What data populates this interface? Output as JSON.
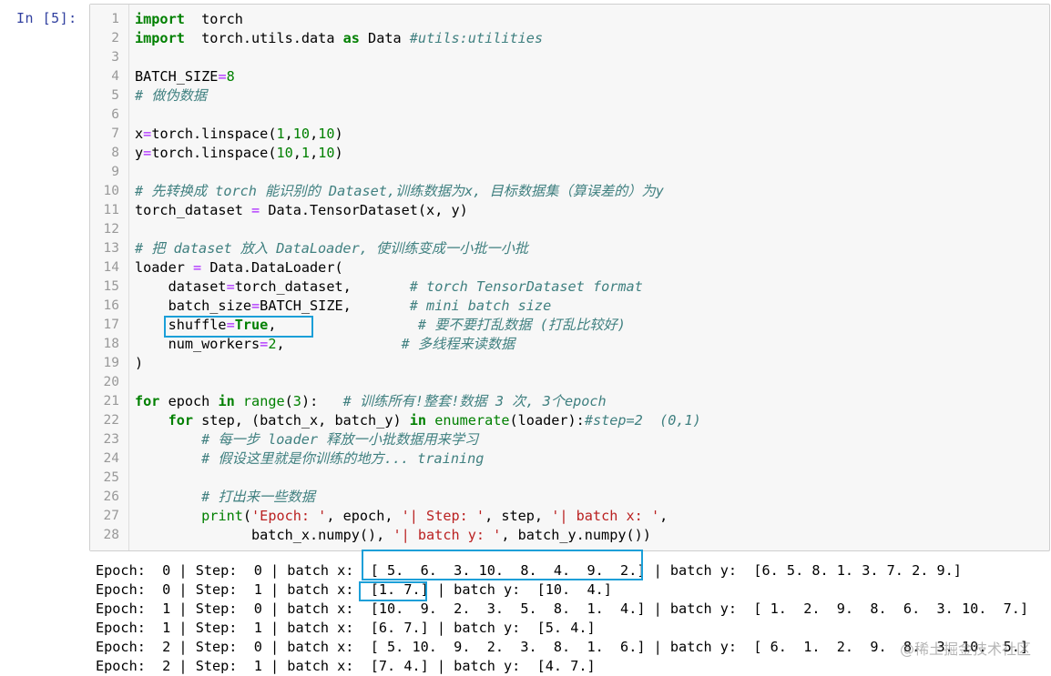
{
  "prompt": "In  [5]:",
  "code_lines": [
    {
      "n": "1",
      "segs": [
        [
          "kw",
          "import"
        ],
        [
          "",
          "  torch"
        ]
      ]
    },
    {
      "n": "2",
      "segs": [
        [
          "kw",
          "import"
        ],
        [
          "",
          "  torch.utils.data "
        ],
        [
          "kw",
          "as"
        ],
        [
          "",
          " Data "
        ],
        [
          "cm",
          "#utils:utilities"
        ]
      ]
    },
    {
      "n": "3",
      "segs": []
    },
    {
      "n": "4",
      "segs": [
        [
          "",
          "BATCH_SIZE"
        ],
        [
          "op",
          "="
        ],
        [
          "num",
          "8"
        ]
      ]
    },
    {
      "n": "5",
      "segs": [
        [
          "cm",
          "# 做伪数据"
        ]
      ]
    },
    {
      "n": "6",
      "segs": []
    },
    {
      "n": "7",
      "segs": [
        [
          "",
          "x"
        ],
        [
          "op",
          "="
        ],
        [
          "",
          "torch.linspace("
        ],
        [
          "num",
          "1"
        ],
        [
          "",
          ","
        ],
        [
          "num",
          "10"
        ],
        [
          "",
          ","
        ],
        [
          "num",
          "10"
        ],
        [
          "",
          ")"
        ]
      ]
    },
    {
      "n": "8",
      "segs": [
        [
          "",
          "y"
        ],
        [
          "op",
          "="
        ],
        [
          "",
          "torch.linspace("
        ],
        [
          "num",
          "10"
        ],
        [
          "",
          ","
        ],
        [
          "num",
          "1"
        ],
        [
          "",
          ","
        ],
        [
          "num",
          "10"
        ],
        [
          "",
          ")"
        ]
      ]
    },
    {
      "n": "9",
      "segs": []
    },
    {
      "n": "10",
      "segs": [
        [
          "cm",
          "# 先转换成 torch 能识别的 Dataset,训练数据为x, 目标数据集（算误差的）为y"
        ]
      ]
    },
    {
      "n": "11",
      "segs": [
        [
          "",
          "torch_dataset "
        ],
        [
          "op",
          "="
        ],
        [
          "",
          " Data.TensorDataset(x, y)"
        ]
      ]
    },
    {
      "n": "12",
      "segs": []
    },
    {
      "n": "13",
      "segs": [
        [
          "cm",
          "# 把 dataset 放入 DataLoader, 使训练变成一小批一小批"
        ]
      ]
    },
    {
      "n": "14",
      "segs": [
        [
          "",
          "loader "
        ],
        [
          "op",
          "="
        ],
        [
          "",
          " Data.DataLoader("
        ]
      ]
    },
    {
      "n": "15",
      "segs": [
        [
          "",
          "    dataset"
        ],
        [
          "op",
          "="
        ],
        [
          "",
          "torch_dataset,       "
        ],
        [
          "cm",
          "# torch TensorDataset format"
        ]
      ]
    },
    {
      "n": "16",
      "segs": [
        [
          "",
          "    batch_size"
        ],
        [
          "op",
          "="
        ],
        [
          "",
          "BATCH_SIZE,       "
        ],
        [
          "cm",
          "# mini batch size"
        ]
      ]
    },
    {
      "n": "17",
      "segs": [
        [
          "",
          "    shuffle"
        ],
        [
          "op",
          "="
        ],
        [
          "kw",
          "True"
        ],
        [
          "",
          ",                 "
        ],
        [
          "cm",
          "# 要不要打乱数据 (打乱比较好)"
        ]
      ]
    },
    {
      "n": "18",
      "segs": [
        [
          "",
          "    num_workers"
        ],
        [
          "op",
          "="
        ],
        [
          "num",
          "2"
        ],
        [
          "",
          ",              "
        ],
        [
          "cm",
          "# 多线程来读数据"
        ]
      ]
    },
    {
      "n": "19",
      "segs": [
        [
          "",
          ")"
        ]
      ]
    },
    {
      "n": "20",
      "segs": []
    },
    {
      "n": "21",
      "segs": [
        [
          "kw",
          "for"
        ],
        [
          "",
          " epoch "
        ],
        [
          "kw",
          "in"
        ],
        [
          "",
          " "
        ],
        [
          "bi",
          "range"
        ],
        [
          "",
          "("
        ],
        [
          "num",
          "3"
        ],
        [
          "",
          "):   "
        ],
        [
          "cm",
          "# 训练所有!整套!数据 3 次, 3个epoch"
        ]
      ]
    },
    {
      "n": "22",
      "segs": [
        [
          "",
          "    "
        ],
        [
          "kw",
          "for"
        ],
        [
          "",
          " step, (batch_x, batch_y) "
        ],
        [
          "kw",
          "in"
        ],
        [
          "",
          " "
        ],
        [
          "bi",
          "enumerate"
        ],
        [
          "",
          "(loader):"
        ],
        [
          "cm",
          "#step=2  (0,1)"
        ]
      ]
    },
    {
      "n": "23",
      "segs": [
        [
          "",
          "        "
        ],
        [
          "cm",
          "# 每一步 loader 释放一小批数据用来学习"
        ]
      ]
    },
    {
      "n": "24",
      "segs": [
        [
          "",
          "        "
        ],
        [
          "cm",
          "# 假设这里就是你训练的地方... training"
        ]
      ]
    },
    {
      "n": "25",
      "segs": []
    },
    {
      "n": "26",
      "segs": [
        [
          "",
          "        "
        ],
        [
          "cm",
          "# 打出来一些数据"
        ]
      ]
    },
    {
      "n": "27",
      "segs": [
        [
          "",
          "        "
        ],
        [
          "bi",
          "print"
        ],
        [
          "",
          "("
        ],
        [
          "str",
          "'Epoch: '"
        ],
        [
          "",
          ", epoch, "
        ],
        [
          "str",
          "'| Step: '"
        ],
        [
          "",
          ", step, "
        ],
        [
          "str",
          "'| batch x: '"
        ],
        [
          "",
          ","
        ]
      ]
    },
    {
      "n": "28",
      "segs": [
        [
          "",
          "              batch_x.numpy(), "
        ],
        [
          "str",
          "'| batch y: '"
        ],
        [
          "",
          ", batch_y.numpy())"
        ]
      ]
    }
  ],
  "output_lines": [
    "Epoch:  0 | Step:  0 | batch x:  [ 5.  6.  3. 10.  8.  4.  9.  2.] | batch y:  [6. 5. 8. 1. 3. 7. 2. 9.]",
    "Epoch:  0 | Step:  1 | batch x:  [1. 7.] | batch y:  [10.  4.]",
    "Epoch:  1 | Step:  0 | batch x:  [10.  9.  2.  3.  5.  8.  1.  4.] | batch y:  [ 1.  2.  9.  8.  6.  3. 10.  7.]",
    "Epoch:  1 | Step:  1 | batch x:  [6. 7.] | batch y:  [5. 4.]",
    "Epoch:  2 | Step:  0 | batch x:  [ 5. 10.  9.  2.  3.  8.  1.  6.] | batch y:  [ 6.  1.  2.  9.  8.  3. 10.  5.]",
    "Epoch:  2 | Step:  1 | batch x:  [7. 4.] | batch y:  [4. 7.]"
  ],
  "watermark": "@稀土掘金技术社区",
  "colors": {
    "highlight_box": "#1b9fd8",
    "prompt": "#303f9f",
    "keyword": "#008000",
    "comment": "#408080",
    "string": "#ba2121"
  }
}
